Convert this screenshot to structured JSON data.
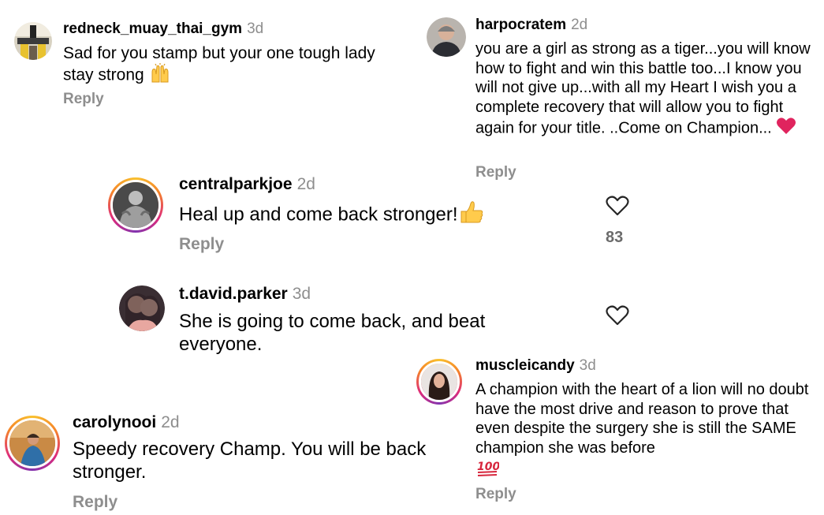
{
  "comments": [
    {
      "username": "redneck_muay_thai_gym",
      "time": "3d",
      "text": "Sad for you stamp but your one tough lady stay strong",
      "reply": "Reply"
    },
    {
      "username": "harpocratem",
      "time": "2d",
      "text": "you are a girl as strong as a tiger...you will know how to fight and win this battle too...I know you will not give up...with all my Heart I wish you a complete recovery that will allow you to fight again for your title. ..Come on Champion...",
      "reply": "Reply"
    },
    {
      "username": "centralparkjoe",
      "time": "2d",
      "text": "Heal up and come back stronger!",
      "reply": "Reply",
      "likes": "83"
    },
    {
      "username": "t.david.parker",
      "time": "3d",
      "text": "She is going to come back, and beat everyone."
    },
    {
      "username": "muscleicandy",
      "time": "3d",
      "text": "A champion with the heart of a lion will no doubt have the most drive and reason to prove that even despite the surgery she is still the SAME champion she was before",
      "reply": "Reply"
    },
    {
      "username": "carolynooi",
      "time": "2d",
      "text": "Speedy recovery Champ. You will be back stronger.",
      "reply": "Reply"
    }
  ],
  "icons": {
    "praise": "raised-hands-icon",
    "love": "red-heart-icon",
    "thumb": "thumbs-up-icon",
    "hundred": "hundred-points-icon",
    "like": "heart-outline-icon"
  },
  "colors": {
    "text": "#000000",
    "muted": "#8e8e8e",
    "heart": "#e0245e",
    "emoji_yellow": "#ffcb4c"
  }
}
